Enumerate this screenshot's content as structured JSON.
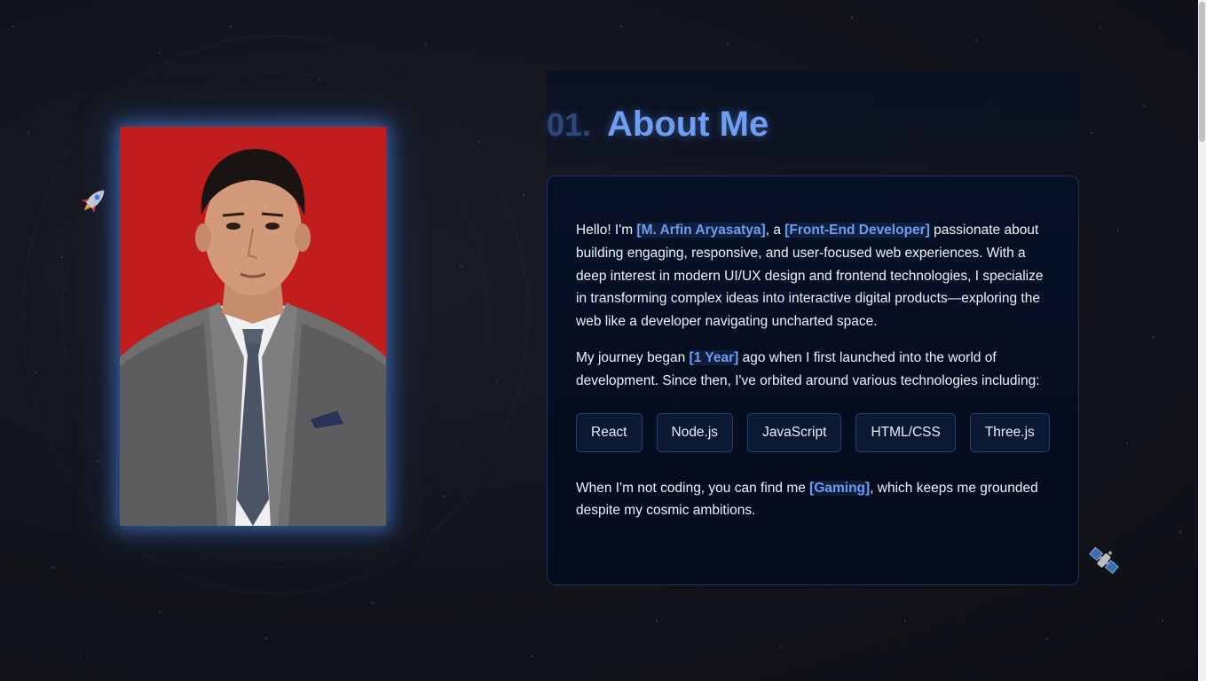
{
  "section": {
    "number": "01.",
    "title": "About Me"
  },
  "about": {
    "p1": {
      "t1": "Hello! I'm ",
      "name": "[M. Arfin Aryasatya]",
      "t2": ", a ",
      "role": "[Front-End Developer]",
      "t3": " passionate about building engaging, responsive, and user-focused web experiences. With a deep interest in modern UI/UX design and frontend technologies, I specialize in transforming complex ideas into interactive digital products—exploring the web like a developer navigating uncharted space."
    },
    "p2": {
      "t1": "My journey began ",
      "duration": "[1 Year]",
      "t2": " ago when I first launched into the world of development. Since then, I've orbited around various technologies including:"
    },
    "skills": [
      "React",
      "Node.js",
      "JavaScript",
      "HTML/CSS",
      "Three.js"
    ],
    "p3": {
      "t1": "When I'm not coding, you can find me ",
      "hobby": "[Gaming]",
      "t2": ", which keeps me grounded despite my cosmic ambitions."
    }
  },
  "icons": {
    "rocket": "rocket-icon",
    "satellite": "satellite-icon"
  },
  "colors": {
    "accent": "#6e9cf0",
    "photo_background": "#c21d1d",
    "card_background": "#050d20"
  }
}
